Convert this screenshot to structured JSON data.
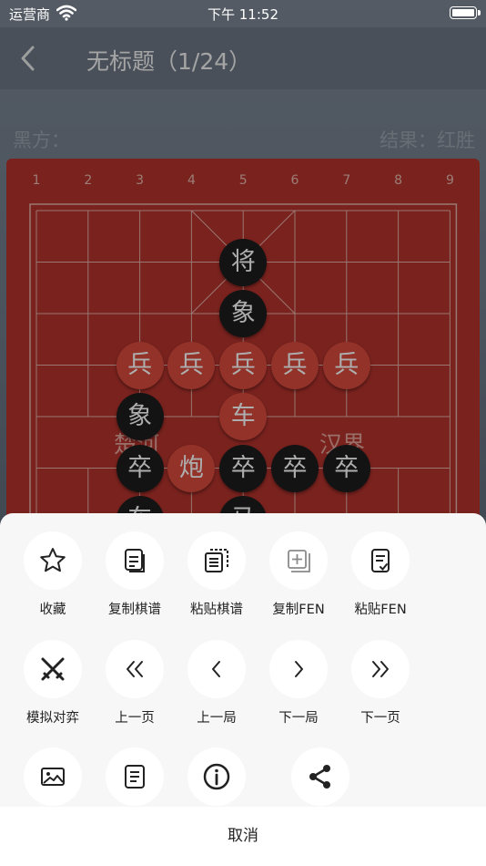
{
  "status_bar": {
    "carrier": "运营商",
    "time": "下午 11:52"
  },
  "navbar": {
    "title": "无标题（1/24）"
  },
  "game_info": {
    "black_label": "黑方：",
    "result": "结果：红胜"
  },
  "board": {
    "column_numbers": [
      "1",
      "2",
      "3",
      "4",
      "5",
      "6",
      "7",
      "8",
      "9"
    ],
    "river_left": "楚河",
    "river_right": "汉界",
    "pieces": [
      {
        "char": "将",
        "side": "black"
      },
      {
        "char": "象",
        "side": "black"
      },
      {
        "char": "兵",
        "side": "red"
      },
      {
        "char": "兵",
        "side": "red"
      },
      {
        "char": "兵",
        "side": "red"
      },
      {
        "char": "兵",
        "side": "red"
      },
      {
        "char": "兵",
        "side": "red"
      },
      {
        "char": "象",
        "side": "black"
      },
      {
        "char": "车",
        "side": "red"
      },
      {
        "char": "卒",
        "side": "black"
      },
      {
        "char": "炮",
        "side": "red"
      },
      {
        "char": "卒",
        "side": "black"
      },
      {
        "char": "卒",
        "side": "black"
      },
      {
        "char": "卒",
        "side": "black"
      },
      {
        "char": "车",
        "side": "black"
      },
      {
        "char": "马",
        "side": "black"
      }
    ]
  },
  "sheet": {
    "row1": [
      {
        "label": "收藏",
        "icon": "star-icon"
      },
      {
        "label": "复制棋谱",
        "icon": "copy-record-icon"
      },
      {
        "label": "粘贴棋谱",
        "icon": "paste-record-icon"
      },
      {
        "label": "复制FEN",
        "icon": "copy-fen-icon"
      },
      {
        "label": "粘贴FEN",
        "icon": "paste-fen-icon"
      }
    ],
    "row2": [
      {
        "label": "模拟对弈",
        "icon": "crossed-swords-icon"
      },
      {
        "label": "上一页",
        "icon": "double-left-icon"
      },
      {
        "label": "上一局",
        "icon": "left-icon"
      },
      {
        "label": "下一局",
        "icon": "right-icon"
      },
      {
        "label": "下一页",
        "icon": "double-right-icon"
      }
    ],
    "row3": [
      {
        "icon": "image-icon"
      },
      {
        "icon": "document-icon"
      },
      {
        "icon": "info-icon"
      },
      {
        "icon": "share-icon"
      }
    ],
    "cancel_label": "取消"
  },
  "colors": {
    "board_red": "#b3332d",
    "red_piece": "#d94b3d",
    "black_piece": "#1c1c1c",
    "sheet_bg": "#f7f7f7"
  }
}
